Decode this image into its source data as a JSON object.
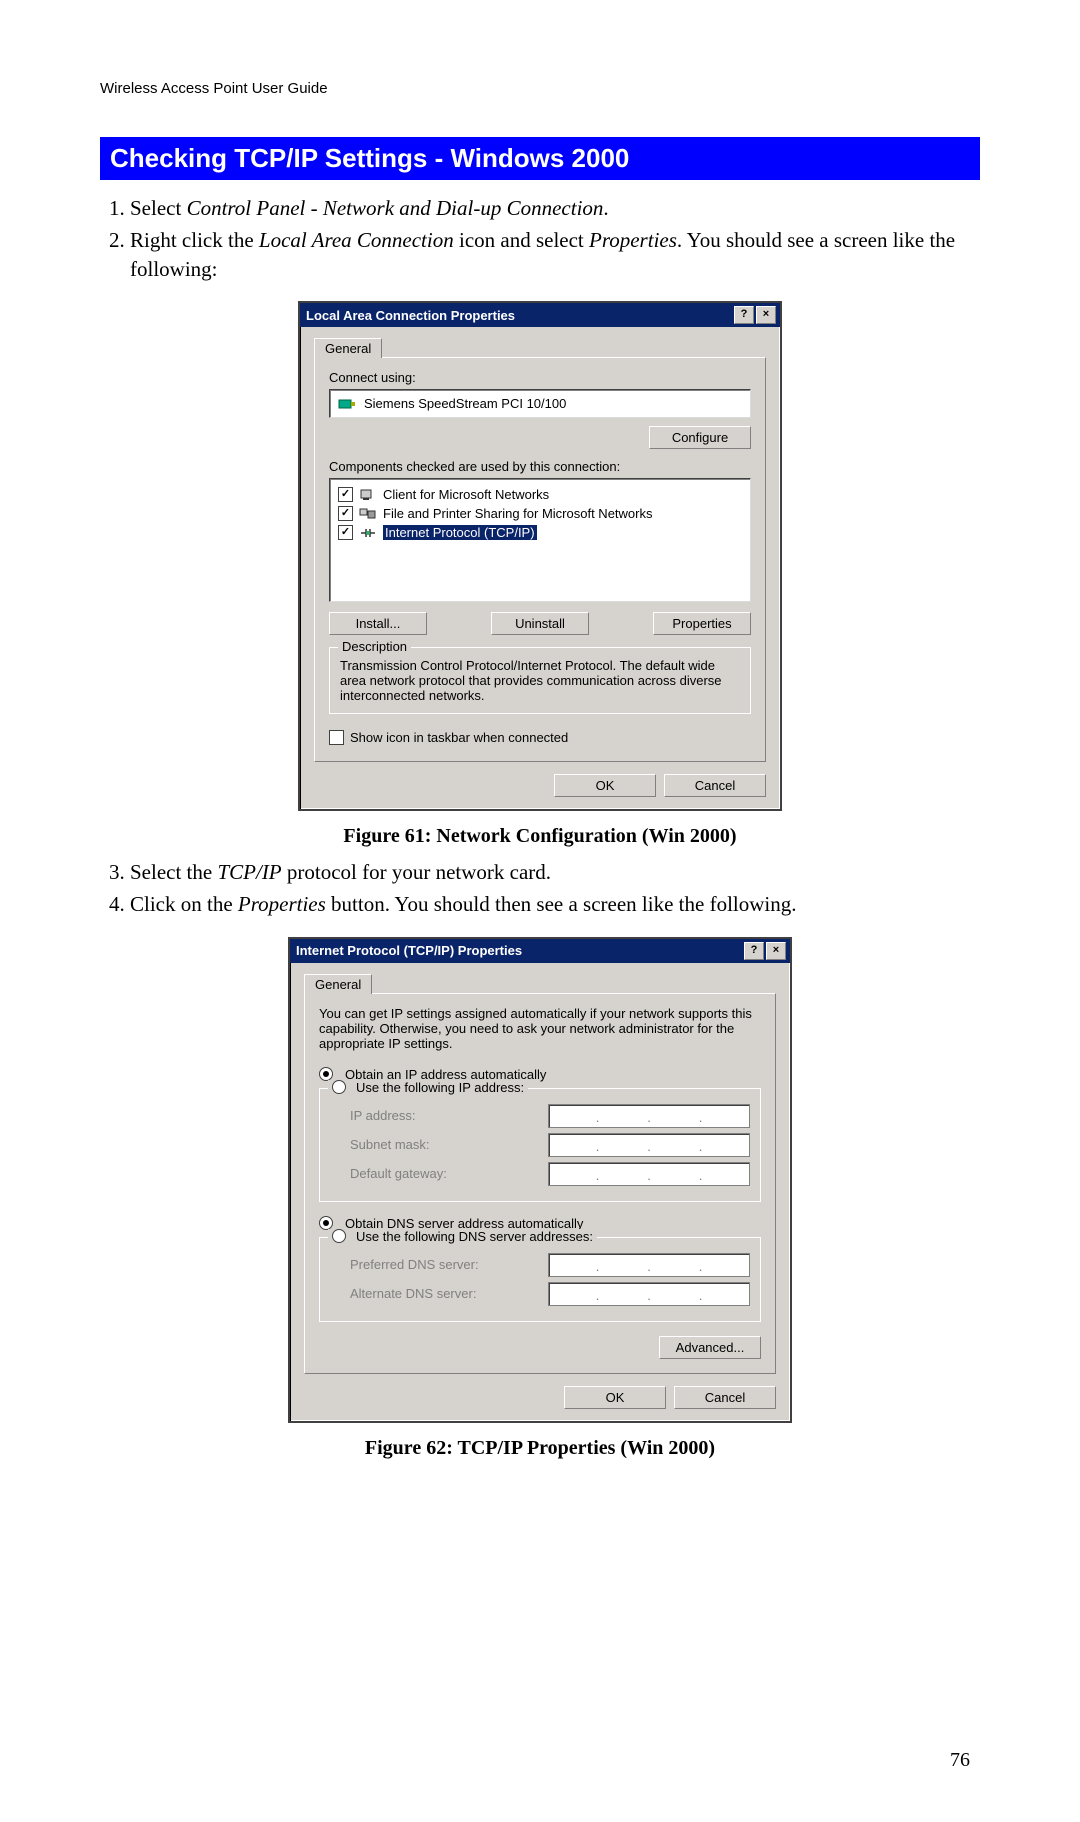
{
  "running_header": "Wireless Access Point User Guide",
  "page_number": "76",
  "section_heading": "Checking TCP/IP Settings - Windows 2000",
  "steps_a": {
    "s1_pre": "Select ",
    "s1_em": "Control Panel - Network and Dial-up Connection",
    "s1_post": ".",
    "s2_pre": "Right click the ",
    "s2_em1": "Local Area Connection",
    "s2_mid": " icon and select ",
    "s2_em2": "Properties",
    "s2_post": ". You should see a screen like the following:"
  },
  "fig61_caption": "Figure 61: Network Configuration (Win 2000)",
  "steps_b": {
    "s3_pre": "Select the ",
    "s3_em": "TCP/IP",
    "s3_post": " protocol for your network card.",
    "s4_pre": "Click on the ",
    "s4_em": "Properties",
    "s4_post": " button. You should then see a screen like the following."
  },
  "fig62_caption": "Figure 62: TCP/IP Properties (Win 2000)",
  "dlg1": {
    "title": "Local Area Connection Properties",
    "help_btn": "?",
    "close_btn": "×",
    "tab_general": "General",
    "connect_using_label": "Connect using:",
    "adapter_name": "Siemens SpeedStream PCI 10/100",
    "configure_btn": "Configure",
    "components_label": "Components checked are used by this connection:",
    "comp1": "Client for Microsoft Networks",
    "comp2": "File and Printer Sharing for Microsoft Networks",
    "comp3": "Internet Protocol (TCP/IP)",
    "install_btn": "Install...",
    "uninstall_btn": "Uninstall",
    "properties_btn": "Properties",
    "desc_title": "Description",
    "desc_text": "Transmission Control Protocol/Internet Protocol. The default wide area network protocol that provides communication across diverse interconnected networks.",
    "show_icon_label": "Show icon in taskbar when connected",
    "ok_btn": "OK",
    "cancel_btn": "Cancel"
  },
  "dlg2": {
    "title": "Internet Protocol (TCP/IP) Properties",
    "help_btn": "?",
    "close_btn": "×",
    "tab_general": "General",
    "intro_text": "You can get IP settings assigned automatically if your network supports this capability. Otherwise, you need to ask your network administrator for the appropriate IP settings.",
    "r_obtain_ip": "Obtain an IP address automatically",
    "r_use_ip": "Use the following IP address:",
    "ip_address": "IP address:",
    "subnet": "Subnet mask:",
    "gateway": "Default gateway:",
    "r_obtain_dns": "Obtain DNS server address automatically",
    "r_use_dns": "Use the following DNS server addresses:",
    "pref_dns": "Preferred DNS server:",
    "alt_dns": "Alternate DNS server:",
    "advanced_btn": "Advanced...",
    "ok_btn": "OK",
    "cancel_btn": "Cancel"
  }
}
